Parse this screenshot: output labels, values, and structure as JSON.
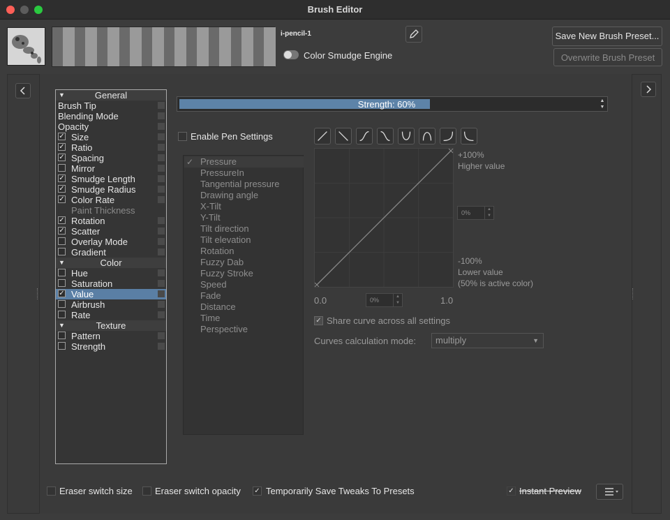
{
  "window": {
    "title": "Brush Editor",
    "traffic_lights": [
      "#fe5f57",
      "#5c5c5c",
      "#2ac940"
    ]
  },
  "preset": {
    "name": "i-pencil-1",
    "engine": "Color Smudge Engine",
    "save_label": "Save New Brush Preset...",
    "overwrite_label": "Overwrite Brush Preset"
  },
  "options": [
    {
      "type": "header",
      "label": "General"
    },
    {
      "type": "item",
      "label": "Brush Tip",
      "checkbox": false
    },
    {
      "type": "item",
      "label": "Blending Mode",
      "checkbox": false
    },
    {
      "type": "item",
      "label": "Opacity",
      "checkbox": false
    },
    {
      "type": "item",
      "label": "Size",
      "checkbox": true,
      "checked": true
    },
    {
      "type": "item",
      "label": "Ratio",
      "checkbox": true,
      "checked": true
    },
    {
      "type": "item",
      "label": "Spacing",
      "checkbox": true,
      "checked": true
    },
    {
      "type": "item",
      "label": "Mirror",
      "checkbox": true,
      "checked": false
    },
    {
      "type": "item",
      "label": "Smudge Length",
      "checkbox": true,
      "checked": true
    },
    {
      "type": "item",
      "label": "Smudge Radius",
      "checkbox": true,
      "checked": true
    },
    {
      "type": "item",
      "label": "Color Rate",
      "checkbox": true,
      "checked": true
    },
    {
      "type": "item",
      "label": "Paint Thickness",
      "checkbox": false,
      "disabled": true
    },
    {
      "type": "item",
      "label": "Rotation",
      "checkbox": true,
      "checked": true
    },
    {
      "type": "item",
      "label": "Scatter",
      "checkbox": true,
      "checked": true
    },
    {
      "type": "item",
      "label": "Overlay Mode",
      "checkbox": true,
      "checked": false
    },
    {
      "type": "item",
      "label": "Gradient",
      "checkbox": true,
      "checked": false
    },
    {
      "type": "header",
      "label": "Color"
    },
    {
      "type": "item",
      "label": "Hue",
      "checkbox": true,
      "checked": false
    },
    {
      "type": "item",
      "label": "Saturation",
      "checkbox": true,
      "checked": false
    },
    {
      "type": "item",
      "label": "Value",
      "checkbox": true,
      "checked": true,
      "selected": true
    },
    {
      "type": "item",
      "label": "Airbrush",
      "checkbox": true,
      "checked": false
    },
    {
      "type": "item",
      "label": "Rate",
      "checkbox": true,
      "checked": false
    },
    {
      "type": "header",
      "label": "Texture"
    },
    {
      "type": "item",
      "label": "Pattern",
      "checkbox": true,
      "checked": false
    },
    {
      "type": "item",
      "label": "Strength",
      "checkbox": true,
      "checked": false
    }
  ],
  "strength": {
    "label": "Strength:  60%",
    "value": 0.6
  },
  "pen_settings": {
    "label": "Enable Pen Settings",
    "checked": false
  },
  "sensors": [
    "Pressure",
    "PressureIn",
    "Tangential pressure",
    "Drawing angle",
    "X-Tilt",
    "Y-Tilt",
    "Tilt direction",
    "Tilt elevation",
    "Rotation",
    "Fuzzy Dab",
    "Fuzzy Stroke",
    "Speed",
    "Fade",
    "Distance",
    "Time",
    "Perspective"
  ],
  "curve_presets": [
    "linear-up-icon",
    "linear-down-icon",
    "s-curve-icon",
    "inverse-s-curve-icon",
    "u-curve-icon",
    "arch-curve-icon",
    "j-curve-icon",
    "l-curve-icon"
  ],
  "curve": {
    "top_value": "+100%",
    "top_desc": "Higher value",
    "mid_value": "0%",
    "bottom_value": "-100%",
    "bottom_desc": "Lower value",
    "bottom_note": "(50% is active color)",
    "x_min": "0.0",
    "x_max": "1.0",
    "x_value": "0%"
  },
  "share_curve": {
    "label": "Share curve across all settings",
    "checked": true
  },
  "calc_mode": {
    "label": "Curves calculation mode:",
    "value": "multiply"
  },
  "bottom": {
    "eraser_size": "Eraser switch size",
    "eraser_opacity": "Eraser switch opacity",
    "temp_save": "Temporarily Save Tweaks To Presets",
    "instant_preview": "Instant Preview"
  }
}
